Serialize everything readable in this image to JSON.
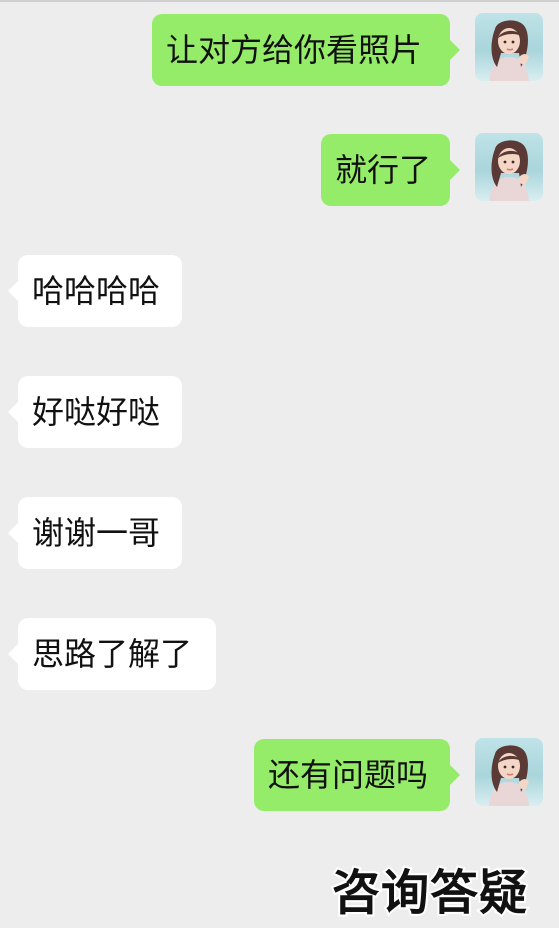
{
  "messages": [
    {
      "side": "out",
      "text": "让对方给你看照片"
    },
    {
      "side": "out",
      "text": "就行了"
    },
    {
      "side": "in",
      "text": "哈哈哈哈"
    },
    {
      "side": "in",
      "text": "好哒好哒"
    },
    {
      "side": "in",
      "text": "谢谢一哥"
    },
    {
      "side": "in",
      "text": "思路了解了"
    },
    {
      "side": "out",
      "text": "还有问题吗"
    }
  ],
  "overlay": {
    "watermark_text": "咨询答疑"
  },
  "colors": {
    "background": "#ededed",
    "outgoing_bubble": "#95ec69",
    "incoming_bubble": "#ffffff"
  }
}
